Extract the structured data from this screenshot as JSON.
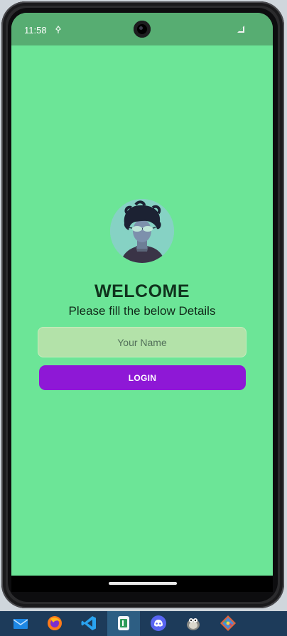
{
  "status_bar": {
    "time": "11:58",
    "left_icon": "signal-alt-icon",
    "right_icon": "signal-icon"
  },
  "screen": {
    "background_color": "#6ce597",
    "avatar_icon": "avatar-image",
    "title": "WELCOME",
    "subtitle": "Please fill the below Details",
    "name_field": {
      "placeholder": "Your Name",
      "value": ""
    },
    "login_button_label": "LOGIN",
    "login_button_color": "#8e18d6"
  },
  "taskbar": {
    "apps": [
      "mail-icon",
      "firefox-icon",
      "vscode-icon",
      "android-studio-icon",
      "discord-icon",
      "gimp-icon",
      "git-icon"
    ]
  }
}
